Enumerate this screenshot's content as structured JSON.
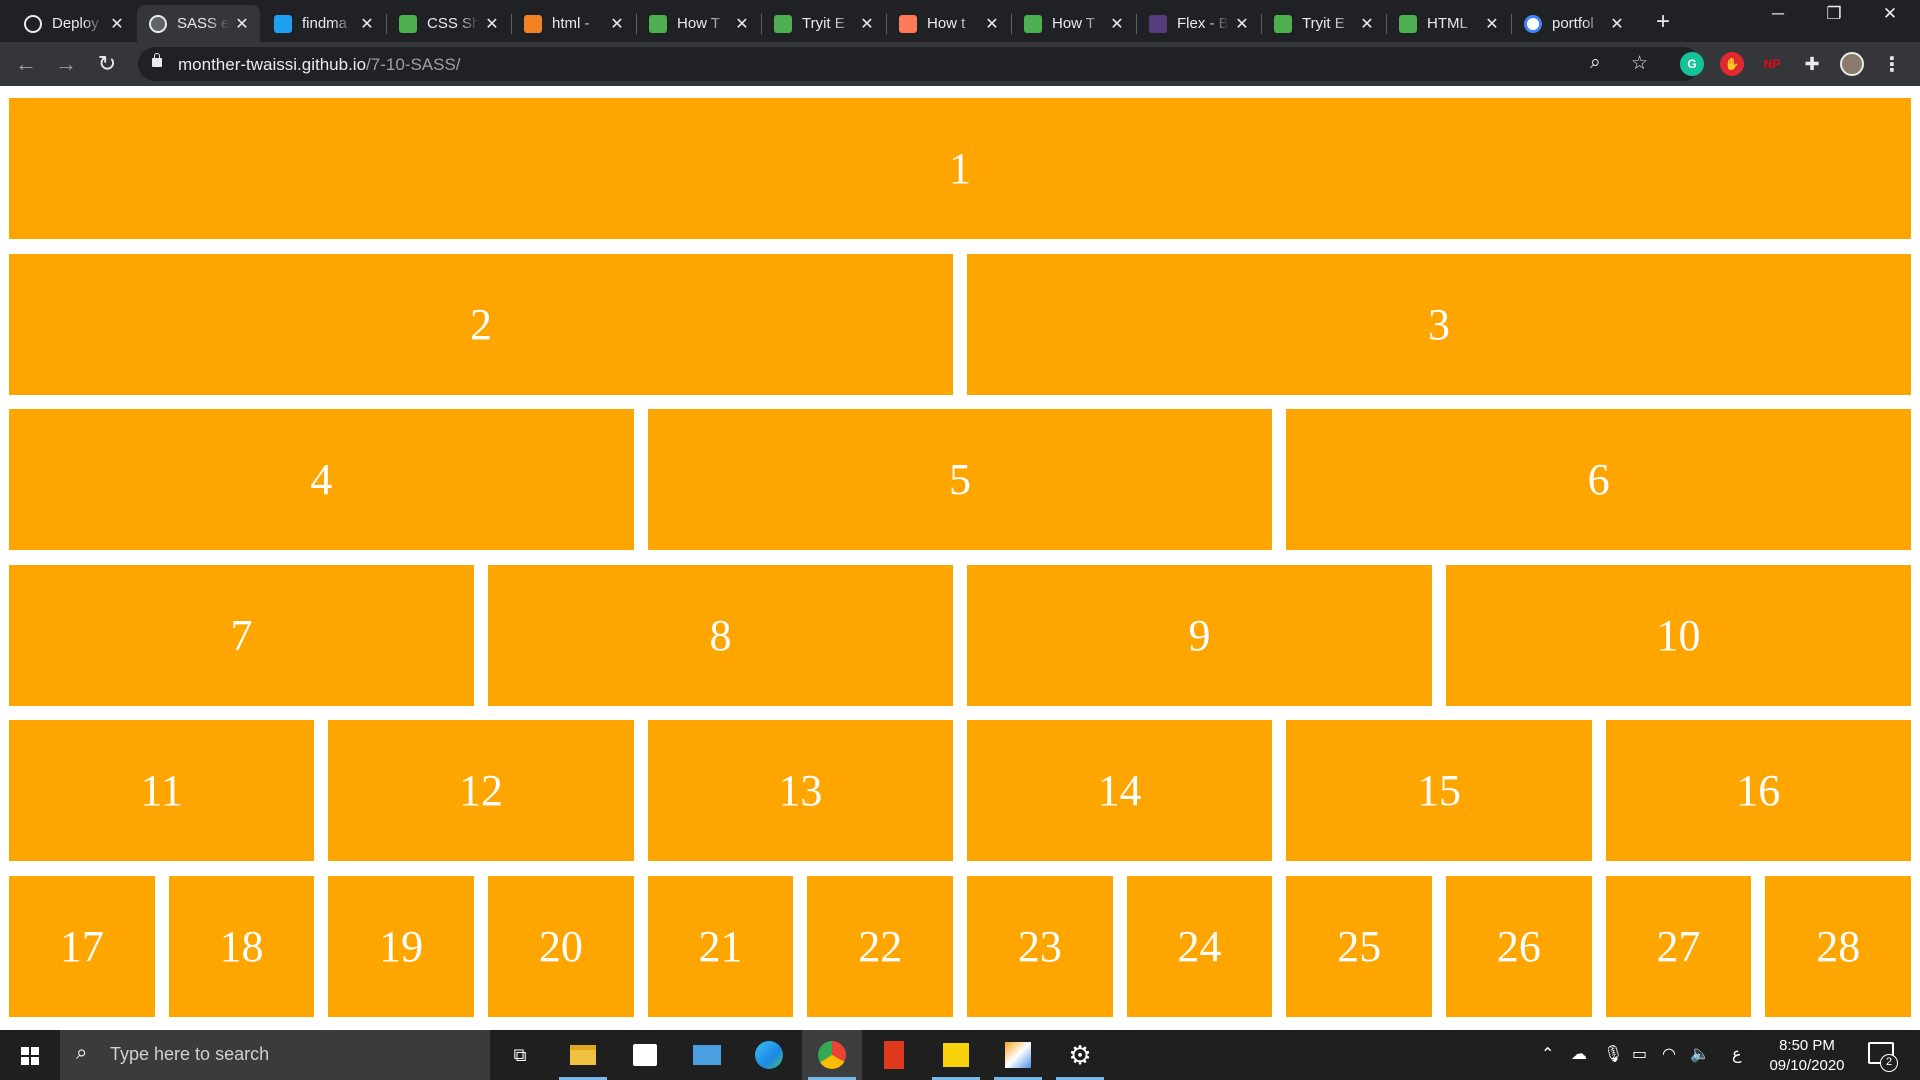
{
  "browser": {
    "tabs": [
      {
        "label": "Deploy",
        "icon": "github-icon",
        "color": "#202124",
        "active": false
      },
      {
        "label": "SASS e",
        "icon": "globe-icon",
        "color": "#5f6368",
        "active": true
      },
      {
        "label": "findma",
        "icon": "findmatch-icon",
        "color": "#1da1f2",
        "active": false
      },
      {
        "label": "CSS Sh",
        "icon": "w3schools-icon",
        "color": "#4caf50",
        "active": false
      },
      {
        "label": "html -",
        "icon": "stackoverflow-icon",
        "color": "#f48024",
        "active": false
      },
      {
        "label": "How T",
        "icon": "w3schools-icon",
        "color": "#4caf50",
        "active": false
      },
      {
        "label": "Tryit E",
        "icon": "w3schools-icon",
        "color": "#4caf50",
        "active": false
      },
      {
        "label": "How t",
        "icon": "hubspot-icon",
        "color": "#ff7a59",
        "active": false
      },
      {
        "label": "How T",
        "icon": "w3schools-icon",
        "color": "#4caf50",
        "active": false
      },
      {
        "label": "Flex - B",
        "icon": "bootstrap-icon",
        "color": "#563d7c",
        "active": false
      },
      {
        "label": "Tryit E",
        "icon": "w3schools-icon",
        "color": "#4caf50",
        "active": false
      },
      {
        "label": "HTML",
        "icon": "w3schools-icon",
        "color": "#4caf50",
        "active": false
      },
      {
        "label": "portfol",
        "icon": "google-icon",
        "color": "#ffffff",
        "active": false
      }
    ],
    "url_host": "monther-twaissi.github.io",
    "url_path": "/7-10-SASS/",
    "extensions": [
      {
        "name": "grammarly-icon",
        "glyph": "G",
        "color": "#15c39a"
      },
      {
        "name": "adblock-icon",
        "glyph": "✋",
        "color": "#e0282e"
      },
      {
        "name": "np-icon",
        "glyph": "NP",
        "color": "#e50914"
      }
    ]
  },
  "page": {
    "rows": [
      [
        "1"
      ],
      [
        "2",
        "3"
      ],
      [
        "4",
        "5",
        "6"
      ],
      [
        "7",
        "8",
        "9",
        "10"
      ],
      [
        "11",
        "12",
        "13",
        "14",
        "15",
        "16"
      ],
      [
        "17",
        "18",
        "19",
        "20",
        "21",
        "22",
        "23",
        "24",
        "25",
        "26",
        "27",
        "28"
      ]
    ],
    "cell_color": "#ffa500"
  },
  "taskbar": {
    "search_placeholder": "Type here to search",
    "time": "8:50 PM",
    "date": "09/10/2020",
    "notification_count": "2",
    "input_indicator": "ع"
  }
}
